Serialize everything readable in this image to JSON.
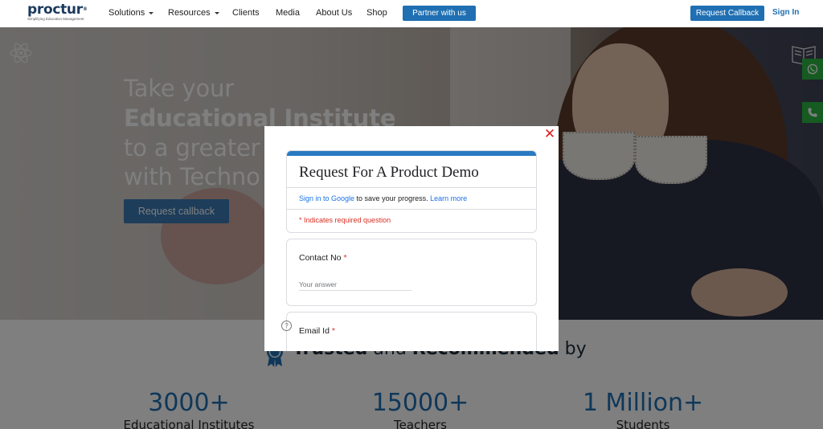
{
  "nav": {
    "logo": {
      "word": "proctur",
      "trademark": "®",
      "tagline": "Simplifying Education Management"
    },
    "items": [
      {
        "label": "Solutions",
        "has_caret": true
      },
      {
        "label": "Resources",
        "has_caret": true
      },
      {
        "label": "Clients",
        "has_caret": false
      },
      {
        "label": "Media",
        "has_caret": false
      },
      {
        "label": "About Us",
        "has_caret": false
      },
      {
        "label": "Shop",
        "has_caret": false
      }
    ],
    "partner_label": "Partner with us",
    "callback_label": "Request Callback",
    "signin_label": "Sign In"
  },
  "hero": {
    "title_lines": [
      "Take your",
      "Educational Institute",
      "to a greater",
      "with Techno"
    ],
    "cta_label": "Request callback"
  },
  "floating": {
    "whatsapp_icon": "whatsapp-icon",
    "phone_icon": "phone-icon"
  },
  "trusted": {
    "w1": "Trusted",
    "w2": "and",
    "w3": "Recommended",
    "w4": "by"
  },
  "stats": [
    {
      "number": "3000+",
      "label": "Educational Institutes"
    },
    {
      "number": "15000+",
      "label": "Teachers"
    },
    {
      "number": "1 Million+",
      "label": "Students"
    }
  ],
  "modal": {
    "close_symbol": "✕",
    "form_title": "Request For A Product Demo",
    "signin_link": "Sign in to Google",
    "signin_rest": " to save your progress.",
    "learn_more": "Learn more",
    "required_note": "* Indicates required question",
    "questions": [
      {
        "label": "Contact No",
        "required_mark": "*",
        "placeholder": "Your answer"
      },
      {
        "label": "Email Id",
        "required_mark": "*"
      }
    ]
  },
  "colors": {
    "brand_blue": "#1f6fb2",
    "required_red": "#d93025",
    "close_red": "#e02020",
    "whatsapp_green": "#2db742"
  }
}
